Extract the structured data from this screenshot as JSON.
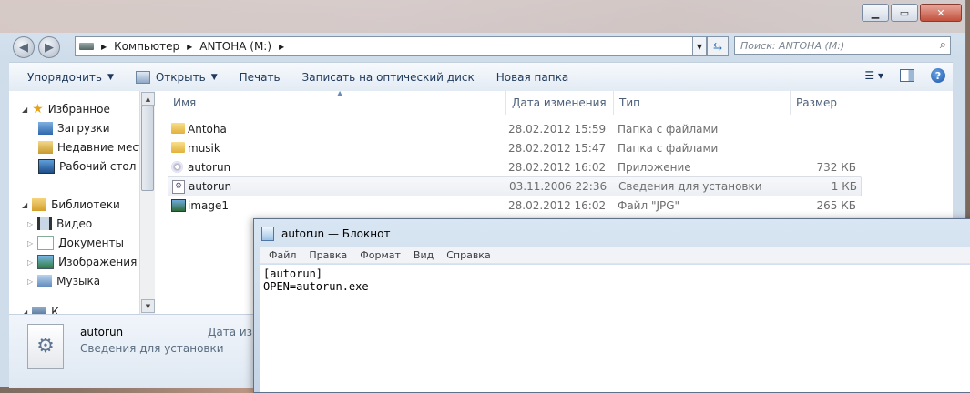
{
  "explorer": {
    "address": {
      "segments": [
        "Компьютер",
        "ANTOHA (M:)"
      ]
    },
    "search_placeholder": "Поиск: ANTOHA (M:)",
    "toolbar": {
      "organize": "Упорядочить",
      "open": "Открыть",
      "print": "Печать",
      "burn": "Записать на оптический диск",
      "new_folder": "Новая папка"
    },
    "nav": {
      "favorites": "Избранное",
      "downloads": "Загрузки",
      "recent": "Недавние места",
      "desktop": "Рабочий стол",
      "libraries": "Библиотеки",
      "video": "Видео",
      "documents": "Документы",
      "pictures": "Изображения",
      "music": "Музыка",
      "computer_partial": "К"
    },
    "columns": {
      "name": "Имя",
      "date": "Дата изменения",
      "type": "Тип",
      "size": "Размер"
    },
    "files": [
      {
        "name": "Antoha",
        "date": "28.02.2012 15:59",
        "type": "Папка с файлами",
        "size": "",
        "icon": "folder-icon"
      },
      {
        "name": "musik",
        "date": "28.02.2012 15:47",
        "type": "Папка с файлами",
        "size": "",
        "icon": "folder-icon"
      },
      {
        "name": "autorun",
        "date": "28.02.2012 16:02",
        "type": "Приложение",
        "size": "732 КБ",
        "icon": "application-icon"
      },
      {
        "name": "autorun",
        "date": "03.11.2006 22:36",
        "type": "Сведения для установки",
        "size": "1 КБ",
        "icon": "setup-info-icon"
      },
      {
        "name": "image1",
        "date": "28.02.2012 16:02",
        "type": "Файл \"JPG\"",
        "size": "265 КБ",
        "icon": "image-file-icon"
      }
    ],
    "details": {
      "name": "autorun",
      "type": "Сведения для установки",
      "date_label_partial": "Дата изм"
    }
  },
  "notepad": {
    "title": "autorun — Блокнот",
    "menu": [
      "Файл",
      "Правка",
      "Формат",
      "Вид",
      "Справка"
    ],
    "text_lines": [
      "[autorun]",
      "OPEN=autorun.exe"
    ]
  }
}
